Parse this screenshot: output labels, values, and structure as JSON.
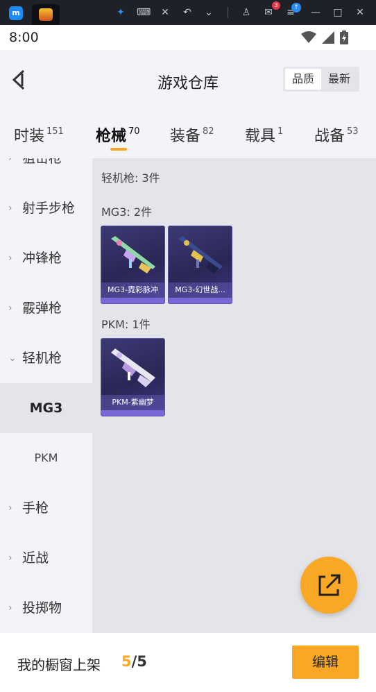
{
  "emulator": {
    "badge_count": "3",
    "colors": {
      "bar": "#1f2129",
      "accent": "#1c8bf3",
      "badge": "#e5364a"
    }
  },
  "status": {
    "time": "8:00"
  },
  "header": {
    "title": "游戏仓库",
    "sort_options": [
      "品质",
      "最新"
    ]
  },
  "tabs": [
    {
      "label": "时装",
      "count": "151"
    },
    {
      "label": "枪械",
      "count": "70",
      "active": true
    },
    {
      "label": "装备",
      "count": "82"
    },
    {
      "label": "载具",
      "count": "1"
    },
    {
      "label": "战备",
      "count": "53"
    }
  ],
  "sidebar": {
    "items": [
      {
        "label": "狙击枪"
      },
      {
        "label": "射手步枪"
      },
      {
        "label": "冲锋枪"
      },
      {
        "label": "霰弹枪"
      },
      {
        "label": "轻机枪",
        "expanded": true
      },
      {
        "label": "MG3",
        "sub": true,
        "active": true
      },
      {
        "label": "PKM",
        "sub": true
      },
      {
        "label": "手枪"
      },
      {
        "label": "近战"
      },
      {
        "label": "投掷物"
      }
    ]
  },
  "content": {
    "category_summary": "轻机枪: 3件",
    "groups": [
      {
        "title": "MG3: 2件",
        "items": [
          {
            "name": "MG3-霓彩脉冲",
            "icon": "machine-gun-icon"
          },
          {
            "name": "MG3-幻世战...",
            "icon": "machine-gun-icon"
          }
        ]
      },
      {
        "title": "PKM: 1件",
        "items": [
          {
            "name": "PKM-紫幽梦",
            "icon": "machine-gun-icon"
          }
        ]
      }
    ]
  },
  "footer": {
    "label": "我的橱窗上架",
    "current": "5",
    "total": "/5",
    "edit_label": "编辑"
  },
  "colors": {
    "accent": "#f9a825",
    "background": "#f3f4f7",
    "panel": "#e3e5ea",
    "card": "#2a2756"
  }
}
